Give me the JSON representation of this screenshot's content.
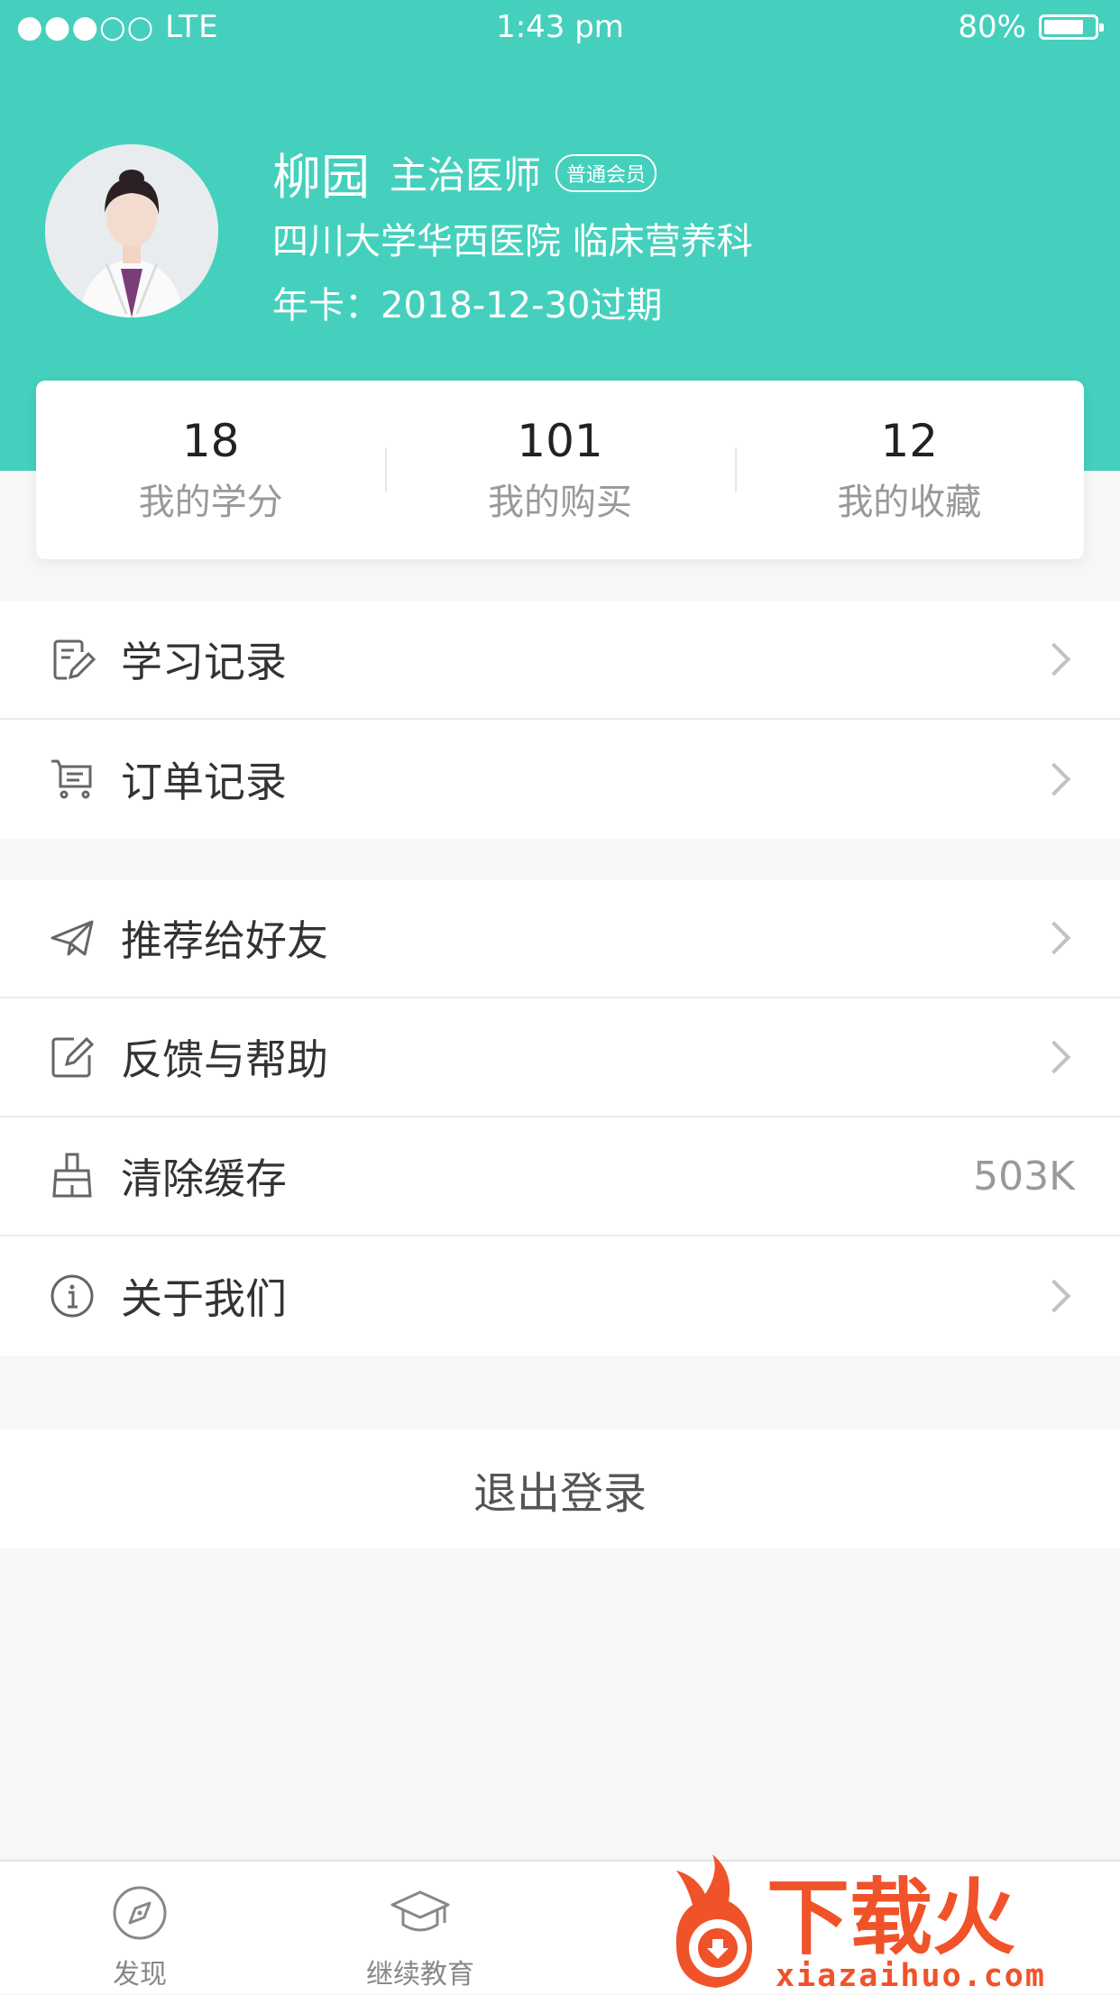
{
  "status_bar": {
    "signal": "●●●○○ LTE",
    "time": "1:43 pm",
    "battery_text": "80%",
    "battery_level": 0.8
  },
  "profile": {
    "name": "柳园",
    "title": "主治医师",
    "badge": "普通会员",
    "hospital": "四川大学华西医院  临床营养科",
    "expiry": "年卡：2018-12-30过期"
  },
  "stats": [
    {
      "value": "18",
      "label": "我的学分"
    },
    {
      "value": "101",
      "label": "我的购买"
    },
    {
      "value": "12",
      "label": "我的收藏"
    }
  ],
  "menu_group_1": [
    {
      "label": "学习记录",
      "icon": "study-record-icon"
    },
    {
      "label": "订单记录",
      "icon": "cart-icon"
    }
  ],
  "menu_group_2": [
    {
      "label": "推荐给好友",
      "icon": "paper-plane-icon"
    },
    {
      "label": "反馈与帮助",
      "icon": "edit-icon"
    },
    {
      "label": "清除缓存",
      "icon": "broom-icon",
      "value": "503K"
    },
    {
      "label": "关于我们",
      "icon": "info-icon"
    }
  ],
  "logout_label": "退出登录",
  "tabs": [
    {
      "label": "发现",
      "icon": "compass-icon"
    },
    {
      "label": "继续教育",
      "icon": "graduation-cap-icon"
    }
  ],
  "watermark": {
    "brand": "下载火",
    "url": "xiazaihuo.com"
  },
  "colors": {
    "accent": "#45d0bd",
    "watermark": "#f0522a"
  }
}
